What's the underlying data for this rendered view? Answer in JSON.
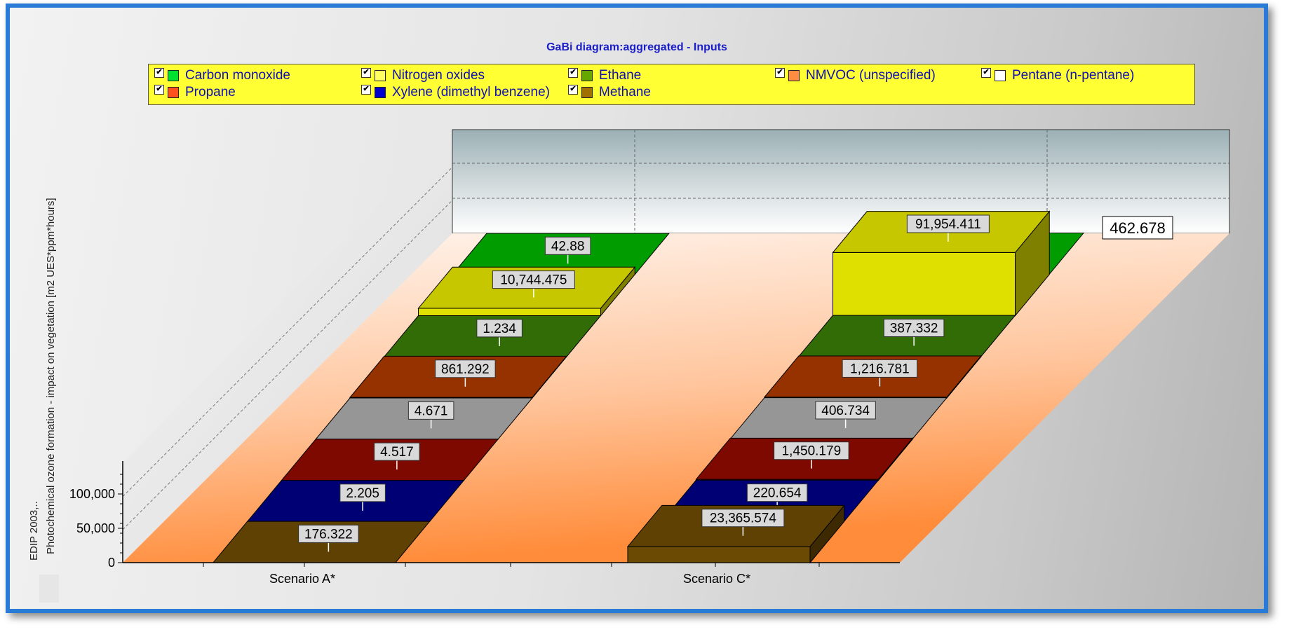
{
  "chart_data": {
    "type": "bar",
    "style": "3d-stacked",
    "title": "GaBi diagram:aggregated - Inputs",
    "ylabel": "Photochemical ozone formation - impact on vegetation  [m2 UES*ppm*hours]",
    "ylabel_prefix": "EDIP 2003,..",
    "yticks": [
      "0",
      "50,000",
      "100,000"
    ],
    "ylim": [
      0,
      100000
    ],
    "categories": [
      "Scenario A*",
      "Scenario C*"
    ],
    "legend_position": "top",
    "series": [
      {
        "name": "Carbon monoxide",
        "color": "#00c800",
        "values": [
          42.88,
          462.678
        ],
        "labels": [
          "42.88",
          "462.678"
        ]
      },
      {
        "name": "Nitrogen oxides",
        "color": "#ffff00",
        "values": [
          10744.475,
          91954.411
        ],
        "labels": [
          "10,744.475",
          "91,954.411"
        ]
      },
      {
        "name": "Ethane",
        "color": "#3f8a08",
        "values": [
          1.234,
          387.332
        ],
        "labels": [
          "1.234",
          "387.332"
        ]
      },
      {
        "name": "NMVOC (unspecified)",
        "color": "#c04000",
        "values": [
          861.292,
          1216.781
        ],
        "labels": [
          "861.292",
          "1,216.781"
        ]
      },
      {
        "name": "Pentane (n-pentane)",
        "color": "#c0c0c0",
        "values": [
          4.671,
          406.734
        ],
        "labels": [
          "4.671",
          "406.734"
        ]
      },
      {
        "name": "Propane",
        "color": "#a00c00",
        "values": [
          4.517,
          1450.179
        ],
        "labels": [
          "4.517",
          "1,450.179"
        ]
      },
      {
        "name": "Xylene (dimethyl benzene)",
        "color": "#000096",
        "values": [
          2.205,
          220.654
        ],
        "labels": [
          "2.205",
          "220.654"
        ]
      },
      {
        "name": "Methane",
        "color": "#7a5404",
        "values": [
          176.322,
          23365.574
        ],
        "labels": [
          "176.322",
          "23,365.574"
        ]
      }
    ]
  },
  "legend": {
    "rows": [
      [
        "Carbon monoxide",
        "Nitrogen oxides",
        "Ethane",
        "NMVOC (unspecified)",
        "Pentane (n-pentane)"
      ],
      [
        "Propane",
        "Xylene (dimethyl benzene)",
        "Methane"
      ]
    ],
    "legend_colors": {
      "Carbon monoxide": "#00e030",
      "Nitrogen oxides": "#ffff60",
      "Ethane": "#66a800",
      "NMVOC (unspecified)": "#ff8c40",
      "Pentane (n-pentane)": "#ffffff",
      "Propane": "#ff5020",
      "Xylene (dimethyl benzene)": "#0000d0",
      "Methane": "#a07000"
    },
    "checkbox_mark": "✔"
  },
  "colors": {
    "frame_border": "#2a7ad8",
    "title": "#1b1fc8",
    "legend_background": "#ffff33",
    "floor_light": "#fff6f0",
    "floor_dark": "#ff8c3a",
    "back_wall": "#aebfc3"
  }
}
